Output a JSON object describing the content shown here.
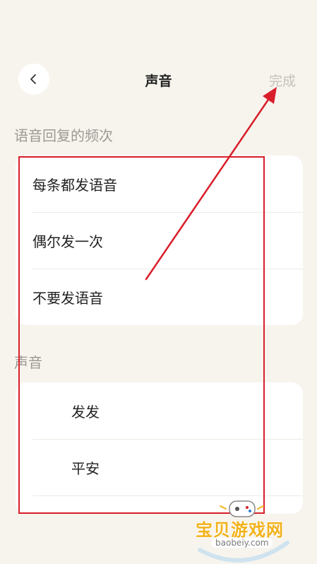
{
  "header": {
    "title": "声音",
    "done_label": "完成"
  },
  "reply_frequency": {
    "label": "语音回复的频次",
    "options": [
      "每条都发语音",
      "偶尔发一次",
      "不要发语音"
    ]
  },
  "voice": {
    "label": "声音",
    "options": [
      "发发",
      "平安"
    ]
  },
  "watermark": {
    "text": "宝贝游戏网",
    "url": "baobeiy.com"
  },
  "colors": {
    "background": "#f7f4ee",
    "annotation": "#d81e2a",
    "watermark": "#f2b21c"
  }
}
